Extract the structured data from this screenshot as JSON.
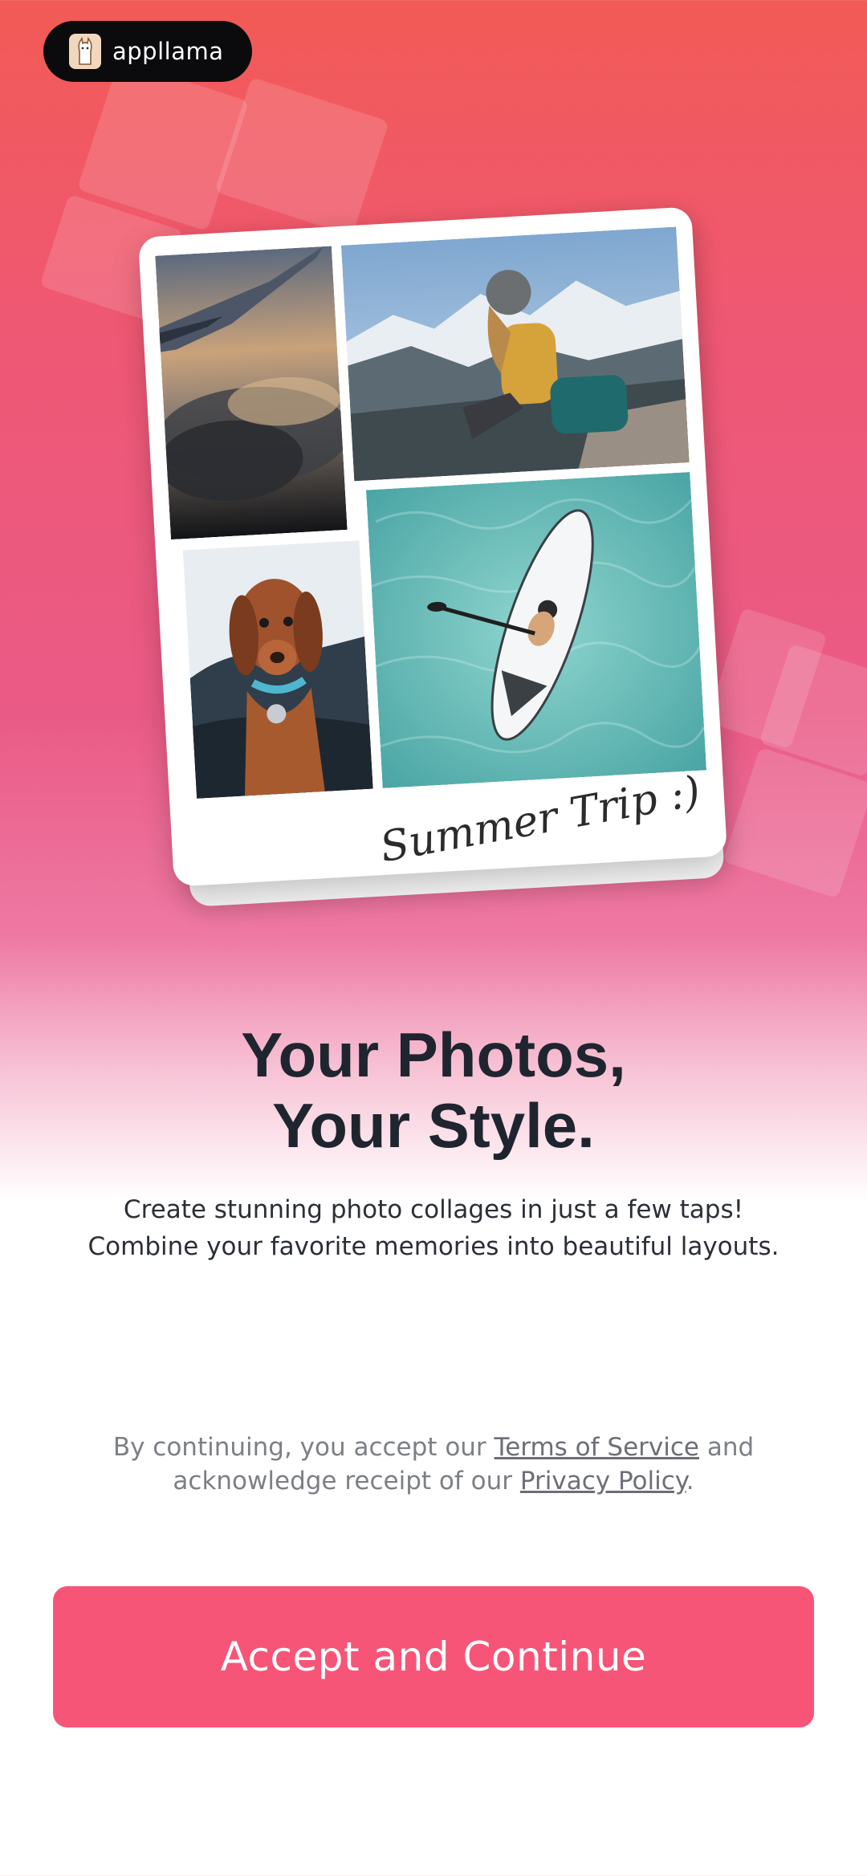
{
  "brand": {
    "name": "appllama",
    "logo_icon": "llama-icon"
  },
  "collage": {
    "caption": "Summer Trip :)",
    "photos": [
      {
        "name": "airplane-wing-sunset"
      },
      {
        "name": "hiker-mountains"
      },
      {
        "name": "dachshund-car"
      },
      {
        "name": "paddleboard-water"
      }
    ]
  },
  "headline": {
    "line1": "Your Photos,",
    "line2": "Your Style."
  },
  "subtitle": {
    "line1": "Create stunning photo collages in just a few taps!",
    "line2": "Combine your favorite memories into beautiful layouts."
  },
  "legal": {
    "prefix": "By continuing, you accept our ",
    "terms_link": "Terms of Service",
    "middle": " and",
    "line2_prefix": "acknowledge receipt of our ",
    "privacy_link": "Privacy Policy",
    "suffix": "."
  },
  "cta": {
    "label": "Accept and Continue"
  },
  "colors": {
    "accent": "#f75577",
    "headline": "#1f252e",
    "badge_bg": "#0b0b0d"
  }
}
